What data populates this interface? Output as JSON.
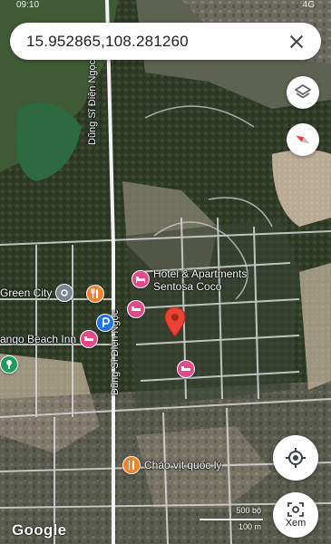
{
  "status_bar": {
    "time": "09:10",
    "signal": "4G"
  },
  "search": {
    "query": "15.952865,108.281260"
  },
  "roads": [
    {
      "name": "Dũng Sĩ Điện Ngọc"
    },
    {
      "name": "Dũng Sĩ Điện Ngọc"
    }
  ],
  "pois": [
    {
      "label": "Hotel & Apartments\nSentosa Coco",
      "type": "hotel",
      "icon": "hotel-bed-icon"
    },
    {
      "label": "Green City",
      "type": "place",
      "icon": "place-icon"
    },
    {
      "label": "",
      "type": "food",
      "icon": "restaurant-icon"
    },
    {
      "label": "",
      "type": "hotel",
      "icon": "hotel-bed-icon"
    },
    {
      "label": "",
      "type": "info",
      "icon": "parking-icon"
    },
    {
      "label": "ango Beach Inn",
      "type": "hotel",
      "icon": "hotel-bed-icon"
    },
    {
      "label": "",
      "type": "park",
      "icon": "park-icon"
    },
    {
      "label": "",
      "type": "hotel",
      "icon": "hotel-bed-icon"
    },
    {
      "label": "Cháo vịt quốc lý",
      "type": "food",
      "icon": "restaurant-icon"
    }
  ],
  "controls": {
    "layers_icon": "layers-icon",
    "compass_icon": "compass-icon",
    "location_icon": "my-location-icon",
    "explore_label": "Xem"
  },
  "attribution": "Google",
  "scale": {
    "top": "500 bộ",
    "bottom": "100 m"
  },
  "colors": {
    "hotel": "#e24a8c",
    "food": "#f2812c",
    "park": "#1f9b5a",
    "info": "#1a73e8",
    "pin": "#ea4335"
  }
}
